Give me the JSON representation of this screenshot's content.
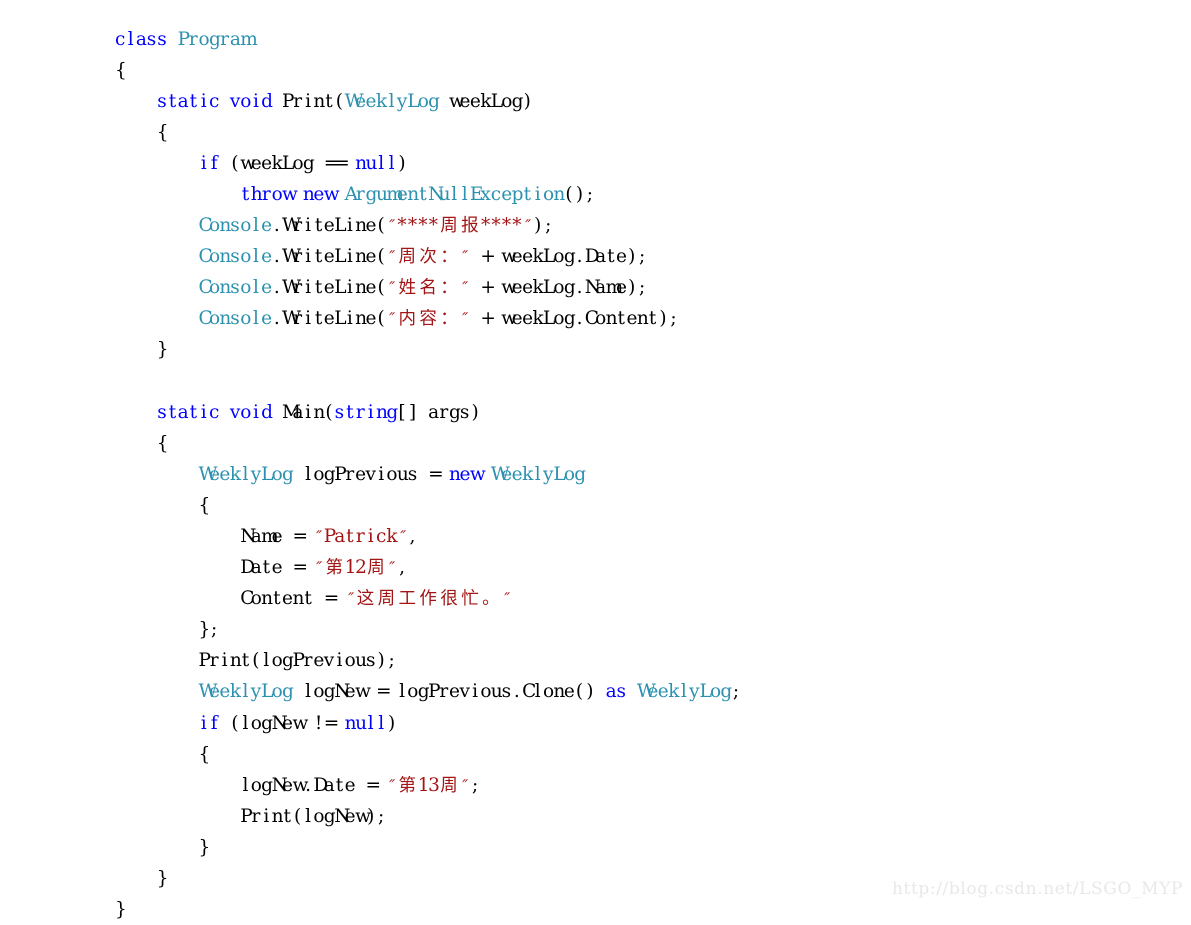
{
  "window": {
    "background_color": "#ffffff",
    "title": "C# code listing — Program.cs"
  },
  "theme": {
    "name": "visual-studio-light",
    "background": "#ffffff",
    "plain_text": "#000000",
    "keyword": "#0000ff",
    "type": "#2b91af",
    "string": "#a31515",
    "watermark": "#e8e8e8"
  },
  "watermark": {
    "text": "http://blog.csdn.net/LSGO_MYP"
  },
  "editor": {
    "language": "C#",
    "indent_unit": "    ",
    "font_size_px": 18.5,
    "line_height_px": 31.1
  },
  "code": {
    "lines": [
      {
        "n": 1,
        "indent": 0,
        "tokens": [
          {
            "t": "keyword",
            "v": "class"
          },
          {
            "t": "plain",
            "v": " "
          },
          {
            "t": "type",
            "v": "Program"
          }
        ]
      },
      {
        "n": 2,
        "indent": 0,
        "tokens": [
          {
            "t": "punct",
            "v": "{"
          }
        ]
      },
      {
        "n": 3,
        "indent": 1,
        "tokens": [
          {
            "t": "keyword",
            "v": "static"
          },
          {
            "t": "plain",
            "v": " "
          },
          {
            "t": "keyword",
            "v": "void"
          },
          {
            "t": "plain",
            "v": " Print("
          },
          {
            "t": "type",
            "v": "WeeklyLog"
          },
          {
            "t": "plain",
            "v": " weekLog)"
          }
        ]
      },
      {
        "n": 4,
        "indent": 1,
        "tokens": [
          {
            "t": "punct",
            "v": "{"
          }
        ]
      },
      {
        "n": 5,
        "indent": 2,
        "tokens": [
          {
            "t": "keyword",
            "v": "if"
          },
          {
            "t": "plain",
            "v": " (weekLog == "
          },
          {
            "t": "keyword",
            "v": "null"
          },
          {
            "t": "plain",
            "v": ")"
          }
        ]
      },
      {
        "n": 6,
        "indent": 3,
        "tokens": [
          {
            "t": "keyword",
            "v": "throw"
          },
          {
            "t": "plain",
            "v": " "
          },
          {
            "t": "keyword",
            "v": "new"
          },
          {
            "t": "plain",
            "v": " "
          },
          {
            "t": "type",
            "v": "ArgumentNullException"
          },
          {
            "t": "plain",
            "v": "();"
          }
        ]
      },
      {
        "n": 7,
        "indent": 2,
        "tokens": [
          {
            "t": "type",
            "v": "Console"
          },
          {
            "t": "plain",
            "v": ".WriteLine("
          },
          {
            "t": "string",
            "v": "\"****周报****\""
          },
          {
            "t": "plain",
            "v": ");"
          }
        ]
      },
      {
        "n": 8,
        "indent": 2,
        "tokens": [
          {
            "t": "type",
            "v": "Console"
          },
          {
            "t": "plain",
            "v": ".WriteLine("
          },
          {
            "t": "string",
            "v": "\"周次：\""
          },
          {
            "t": "plain",
            "v": " + weekLog.Date);"
          }
        ]
      },
      {
        "n": 9,
        "indent": 2,
        "tokens": [
          {
            "t": "type",
            "v": "Console"
          },
          {
            "t": "plain",
            "v": ".WriteLine("
          },
          {
            "t": "string",
            "v": "\"姓名：\""
          },
          {
            "t": "plain",
            "v": " + weekLog.Name);"
          }
        ]
      },
      {
        "n": 10,
        "indent": 2,
        "tokens": [
          {
            "t": "type",
            "v": "Console"
          },
          {
            "t": "plain",
            "v": ".WriteLine("
          },
          {
            "t": "string",
            "v": "\"内容：\""
          },
          {
            "t": "plain",
            "v": " + weekLog.Content);"
          }
        ]
      },
      {
        "n": 11,
        "indent": 1,
        "tokens": [
          {
            "t": "punct",
            "v": "}"
          }
        ]
      },
      {
        "n": 12,
        "indent": 0,
        "tokens": []
      },
      {
        "n": 13,
        "indent": 1,
        "tokens": [
          {
            "t": "keyword",
            "v": "static"
          },
          {
            "t": "plain",
            "v": " "
          },
          {
            "t": "keyword",
            "v": "void"
          },
          {
            "t": "plain",
            "v": " Main("
          },
          {
            "t": "keyword",
            "v": "string"
          },
          {
            "t": "plain",
            "v": "[] args)"
          }
        ]
      },
      {
        "n": 14,
        "indent": 1,
        "tokens": [
          {
            "t": "punct",
            "v": "{"
          }
        ]
      },
      {
        "n": 15,
        "indent": 2,
        "tokens": [
          {
            "t": "type",
            "v": "WeeklyLog"
          },
          {
            "t": "plain",
            "v": " logPrevious = "
          },
          {
            "t": "keyword",
            "v": "new"
          },
          {
            "t": "plain",
            "v": " "
          },
          {
            "t": "type",
            "v": "WeeklyLog"
          }
        ]
      },
      {
        "n": 16,
        "indent": 2,
        "tokens": [
          {
            "t": "punct",
            "v": "{"
          }
        ]
      },
      {
        "n": 17,
        "indent": 3,
        "tokens": [
          {
            "t": "plain",
            "v": "Name = "
          },
          {
            "t": "string",
            "v": "\"Patrick\""
          },
          {
            "t": "plain",
            "v": ","
          }
        ]
      },
      {
        "n": 18,
        "indent": 3,
        "tokens": [
          {
            "t": "plain",
            "v": "Date = "
          },
          {
            "t": "string",
            "v": "\"第12周\""
          },
          {
            "t": "plain",
            "v": ","
          }
        ]
      },
      {
        "n": 19,
        "indent": 3,
        "tokens": [
          {
            "t": "plain",
            "v": "Content = "
          },
          {
            "t": "string",
            "v": "\"这周工作很忙。\""
          }
        ]
      },
      {
        "n": 20,
        "indent": 2,
        "tokens": [
          {
            "t": "punct",
            "v": "};"
          }
        ]
      },
      {
        "n": 21,
        "indent": 2,
        "tokens": [
          {
            "t": "plain",
            "v": "Print(logPrevious);"
          }
        ]
      },
      {
        "n": 22,
        "indent": 2,
        "tokens": [
          {
            "t": "type",
            "v": "WeeklyLog"
          },
          {
            "t": "plain",
            "v": " logNew = logPrevious.Clone() "
          },
          {
            "t": "keyword",
            "v": "as"
          },
          {
            "t": "plain",
            "v": " "
          },
          {
            "t": "type",
            "v": "WeeklyLog"
          },
          {
            "t": "plain",
            "v": ";"
          }
        ]
      },
      {
        "n": 23,
        "indent": 2,
        "tokens": [
          {
            "t": "keyword",
            "v": "if"
          },
          {
            "t": "plain",
            "v": " (logNew != "
          },
          {
            "t": "keyword",
            "v": "null"
          },
          {
            "t": "plain",
            "v": ")"
          }
        ]
      },
      {
        "n": 24,
        "indent": 2,
        "tokens": [
          {
            "t": "punct",
            "v": "{"
          }
        ]
      },
      {
        "n": 25,
        "indent": 3,
        "tokens": [
          {
            "t": "plain",
            "v": "logNew.Date = "
          },
          {
            "t": "string",
            "v": "\"第13周\""
          },
          {
            "t": "plain",
            "v": ";"
          }
        ]
      },
      {
        "n": 26,
        "indent": 3,
        "tokens": [
          {
            "t": "plain",
            "v": "Print(logNew);"
          }
        ]
      },
      {
        "n": 27,
        "indent": 2,
        "tokens": [
          {
            "t": "punct",
            "v": "}"
          }
        ]
      },
      {
        "n": 28,
        "indent": 1,
        "tokens": [
          {
            "t": "punct",
            "v": "}"
          }
        ]
      },
      {
        "n": 29,
        "indent": 0,
        "tokens": [
          {
            "t": "punct",
            "v": "}"
          }
        ]
      }
    ]
  }
}
